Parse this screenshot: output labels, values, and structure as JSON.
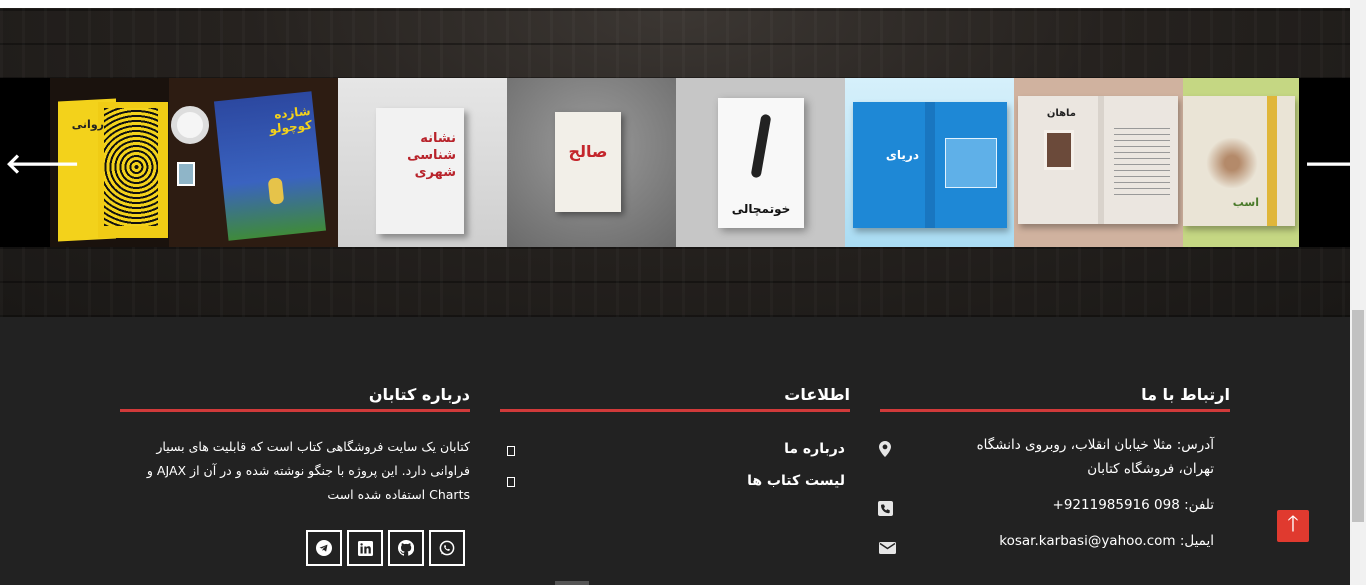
{
  "carousel": {
    "prev_label": "🡐",
    "next_label": "🡒",
    "slides": [
      {
        "title": "روانی",
        "bg": "#1e1510",
        "cover": "#f3d21b"
      },
      {
        "title": "شازده کوچولو",
        "bg": "#2a1a10",
        "cover": "#3050a8"
      },
      {
        "title": "نشانه شناسی شهری",
        "bg": "#d8d8d8",
        "cover": "#efefef"
      },
      {
        "title": "صالح",
        "bg": "#8d8d8d",
        "cover": "#f2efe8"
      },
      {
        "title": "خوتمچالی",
        "bg": "#c9c9c9",
        "cover": "#f7f7f7"
      },
      {
        "title": "دریای",
        "bg": "#bfe4f7",
        "cover": "#1e88d6"
      },
      {
        "title": "ماهان",
        "bg": "#d6b8a4",
        "cover": "#e8e2dc"
      },
      {
        "title": "اسب",
        "bg": "#c8d889",
        "cover": "#eae4d6"
      }
    ]
  },
  "footer": {
    "contact": {
      "title": "ارتباط با ما",
      "address_line1": "آدرس: مثلا خیابان انقلاب، روبروی دانشگاه",
      "address_line2": "تهران، فروشگاه کتابان",
      "phone": "تلفن: 098 9211985916+",
      "email": "ایمیل: kosar.karbasi@yahoo.com"
    },
    "info": {
      "title": "اطلاعات",
      "links": [
        "درباره ما",
        "لیست کتاب ها"
      ]
    },
    "about": {
      "title": "درباره کتابان",
      "line1": "کتابان یک سایت فروشگاهی کتاب است که قابلیت های بسیار",
      "line2": "فراوانی دارد. این پروژه با جنگو نوشته شده و در آن از AJAX و",
      "line3": "Charts استفاده شده است"
    },
    "social": [
      "telegram-icon",
      "linkedin-icon",
      "github-icon",
      "whatsapp-icon"
    ],
    "to_top_label": "🡑"
  },
  "colors": {
    "accent": "#d13a3a",
    "footer_bg": "#222222",
    "to_top": "#e03a2f"
  }
}
